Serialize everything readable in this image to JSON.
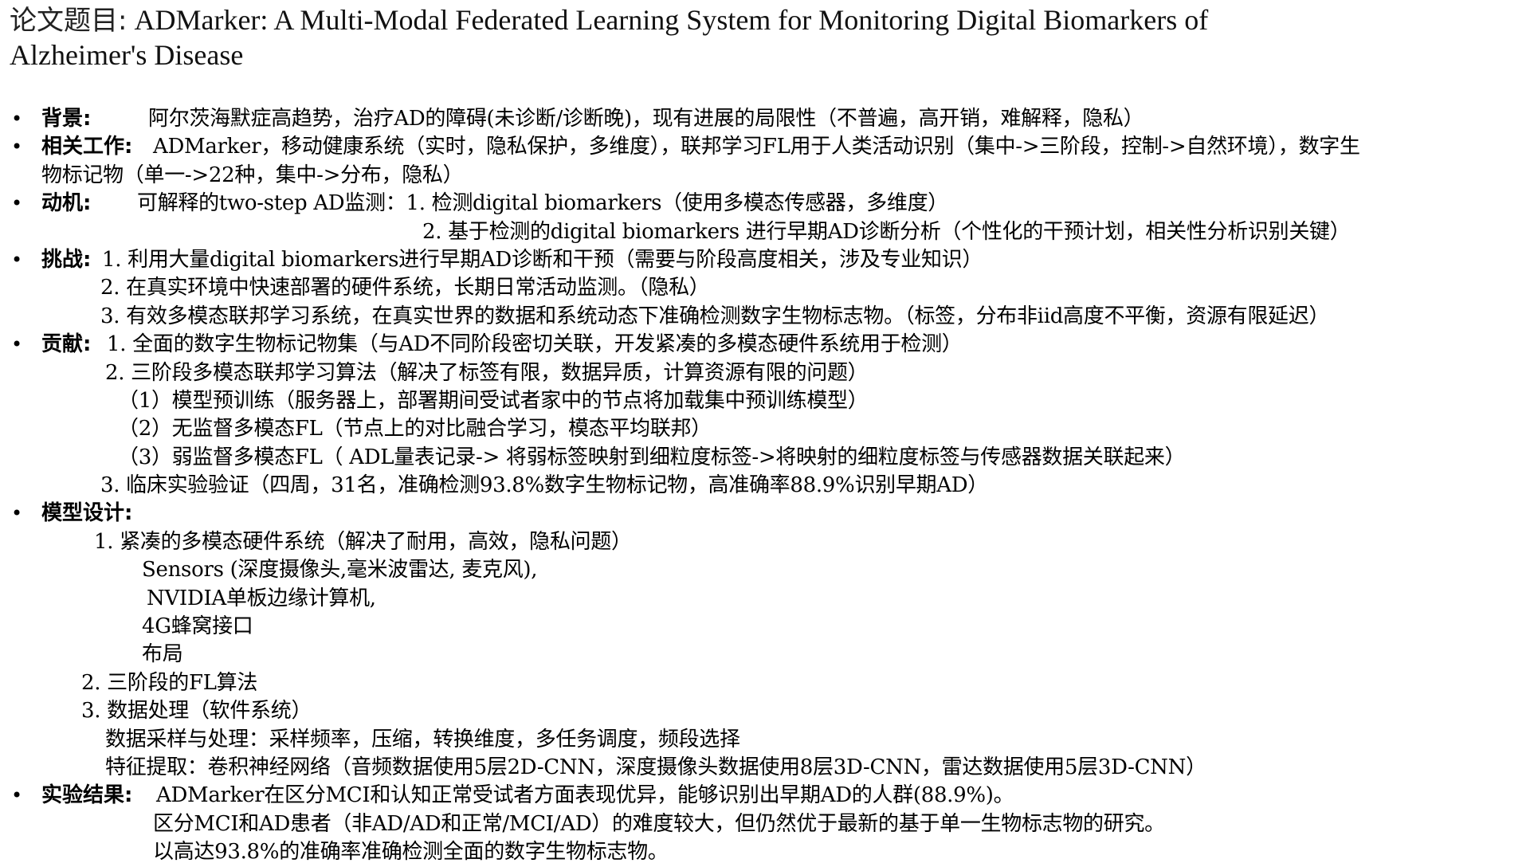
{
  "title": {
    "label": "论文题目:",
    "text": "ADMarker: A Multi-Modal Federated Learning System for Monitoring Digital Biomarkers of",
    "text_line2": "Alzheimer's Disease"
  },
  "bullet_symbol": "•",
  "sections": {
    "background": {
      "key": "背景:",
      "text": "阿尔茨海默症高趋势，治疗AD的障碍(未诊断/诊断晚)，现有进展的局限性（不普遍，高开销，难解释，隐私）"
    },
    "related_work": {
      "key": "相关工作:",
      "text": "ADMarker，移动健康系统（实时，隐私保护，多维度），联邦学习FL用于人类活动识别（集中->三阶段，控制->自然环境），数字生",
      "text_line2": "物标记物（单一->22种，集中->分布，隐私）"
    },
    "motivation": {
      "key": "动机:",
      "text": "可解释的two-step AD监测：1. 检测digital biomarkers（使用多模态传感器，多维度）",
      "text_line2": "2. 基于检测的digital biomarkers 进行早期AD诊断分析（个性化的干预计划，相关性分析识别关键）"
    },
    "challenges": {
      "key": "挑战:",
      "item1": "1. 利用大量digital biomarkers进行早期AD诊断和干预（需要与阶段高度相关，涉及专业知识）",
      "item2": "2. 在真实环境中快速部署的硬件系统，长期日常活动监测。（隐私）",
      "item3": "3. 有效多模态联邦学习系统，在真实世界的数据和系统动态下准确检测数字生物标志物。（标签，分布非iid高度不平衡，资源有限延迟）"
    },
    "contributions": {
      "key": "贡献:",
      "item1": "1. 全面的数字生物标记物集（与AD不同阶段密切关联，开发紧凑的多模态硬件系统用于检测）",
      "item2": "2. 三阶段多模态联邦学习算法（解决了标签有限，数据异质，计算资源有限的问题）",
      "sub1": "（1）模型预训练（服务器上，部署期间受试者家中的节点将加载集中预训练模型）",
      "sub2": "（2）无监督多模态FL（节点上的对比融合学习，模态平均联邦）",
      "sub3": "（3）弱监督多模态FL（ ADL量表记录-> 将弱标签映射到细粒度标签->将映射的细粒度标签与传感器数据关联起来）",
      "item3": "3. 临床实验验证（四周，31名，准确检测93.8%数字生物标记物，高准确率88.9%识别早期AD）"
    },
    "model_design": {
      "key": "模型设计:",
      "item1": "1. 紧凑的多模态硬件系统（解决了耐用，高效，隐私问题）",
      "item1_a": "Sensors (深度摄像头,毫米波雷达, 麦克风),",
      "item1_b": "NVIDIA单板边缘计算机,",
      "item1_c": "4G蜂窝接口",
      "item1_d": "布局",
      "item2": "2. 三阶段的FL算法",
      "item3": "3. 数据处理（软件系统）",
      "item3_a": "数据采样与处理：采样频率，压缩，转换维度，多任务调度，频段选择",
      "item3_b": "特征提取：卷积神经网络（音频数据使用5层2D-CNN，深度摄像头数据使用8层3D-CNN，雷达数据使用5层3D-CNN）"
    },
    "results": {
      "key": "实验结果:",
      "text": "ADMarker在区分MCI和认知正常受试者方面表现优异，能够识别出早期AD的人群(88.9%)。",
      "text_line2": "区分MCI和AD患者（非AD/AD和正常/MCI/AD）的难度较大，但仍然优于最新的基于单一生物标志物的研究。",
      "text_line3": "以高达93.8%的准确率准确检测全面的数字生物标志物。"
    }
  }
}
